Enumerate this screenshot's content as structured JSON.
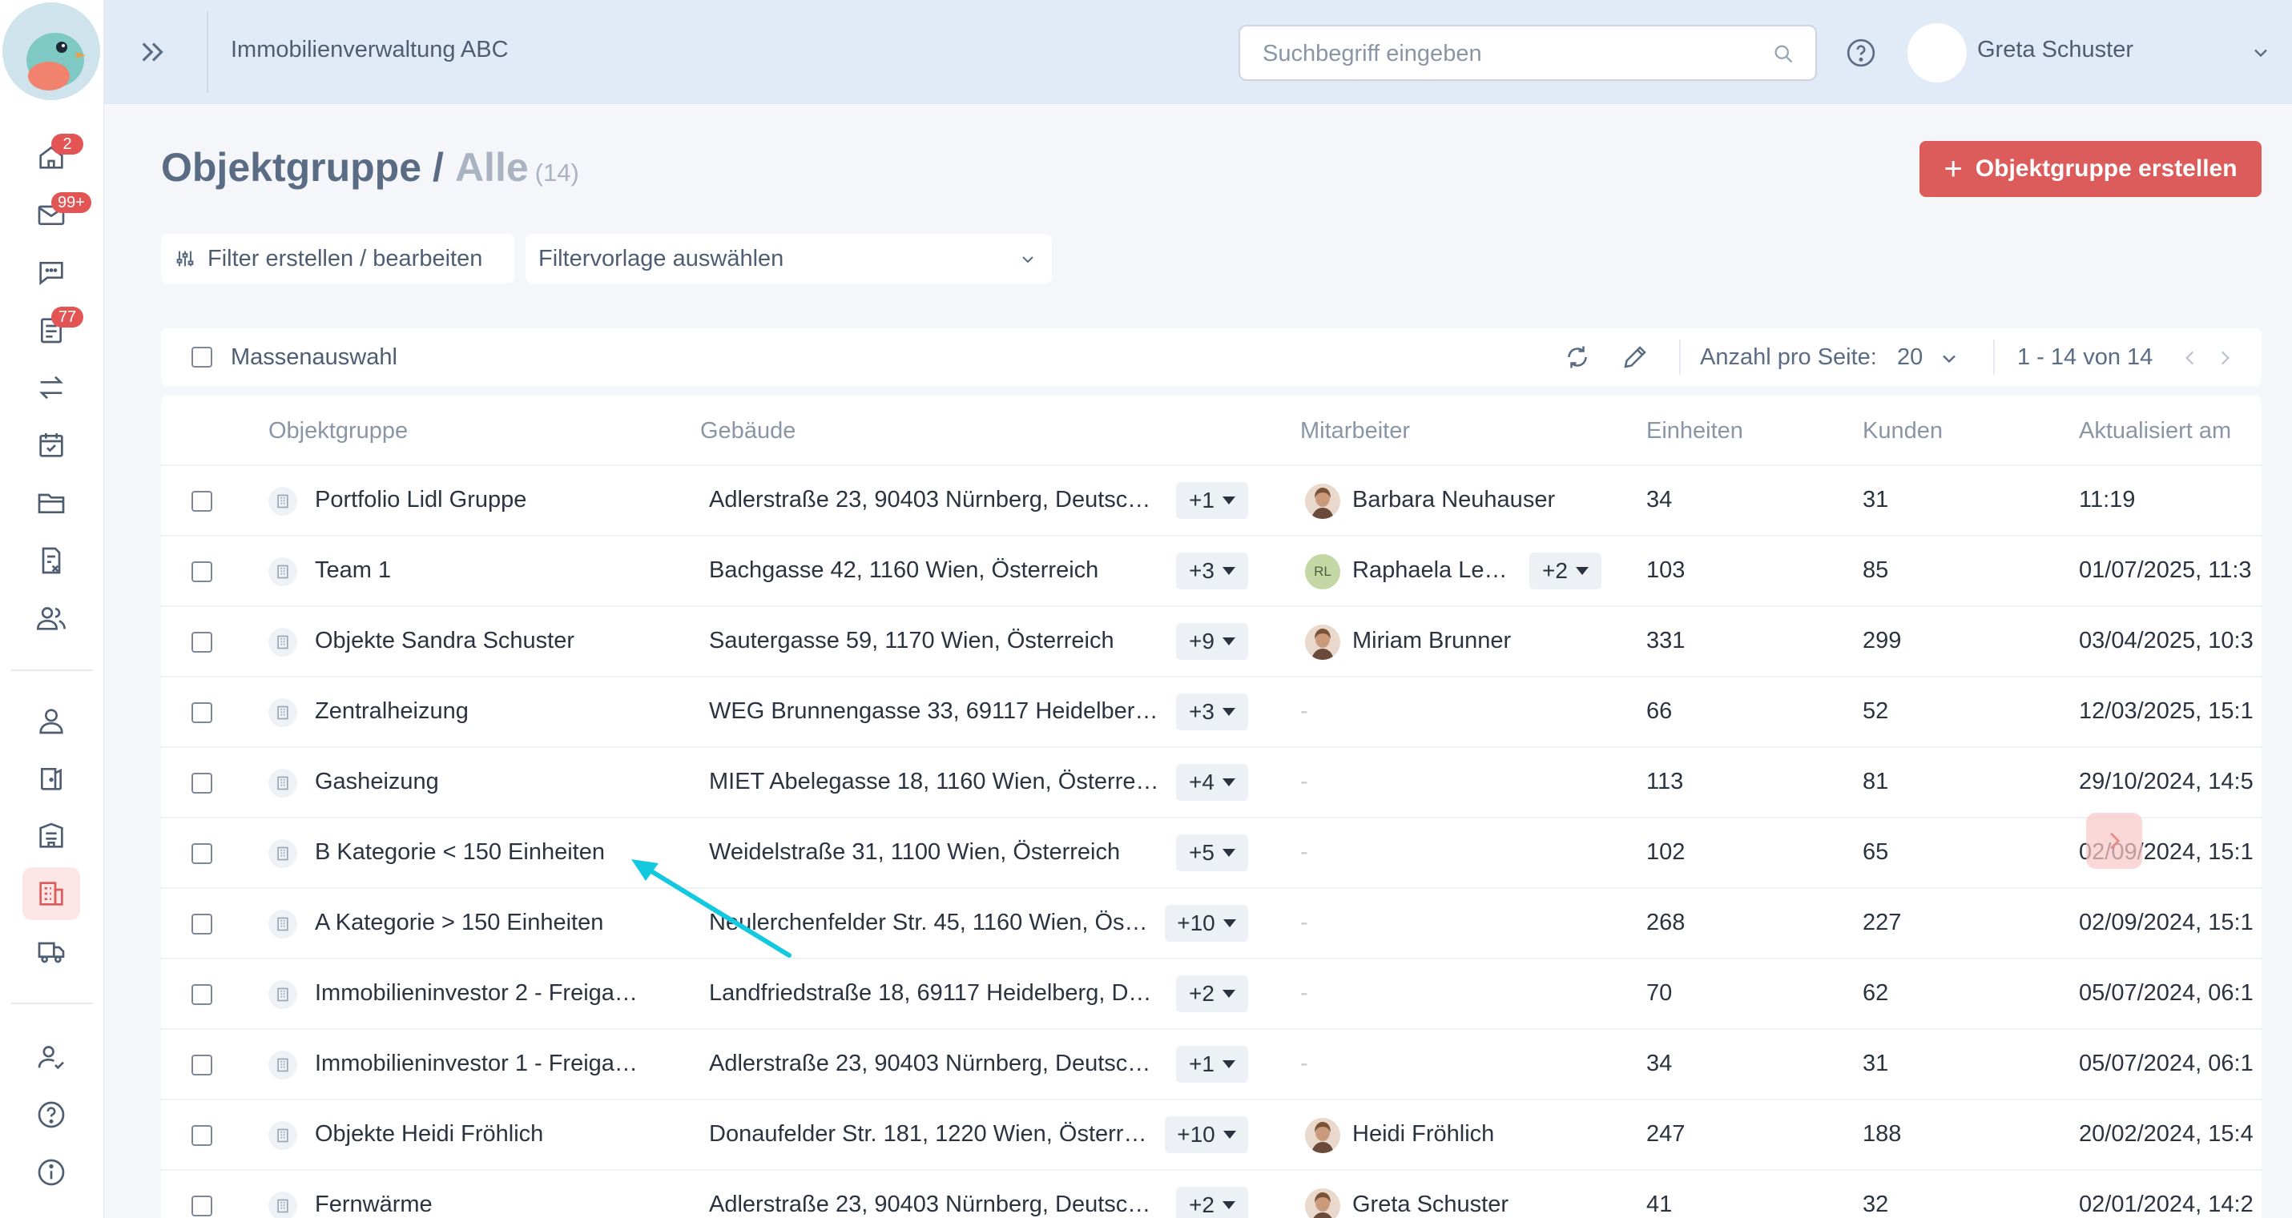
{
  "app": {
    "company": "Immobilienverwaltung ABC",
    "user_name": "Greta Schuster"
  },
  "search": {
    "placeholder": "Suchbegriff eingeben",
    "value": ""
  },
  "sidebar": {
    "items": [
      {
        "name": "home-icon",
        "badge": "2"
      },
      {
        "name": "mail-icon",
        "badge": "99+"
      },
      {
        "name": "chat-icon",
        "badge": ""
      },
      {
        "name": "tasks-icon",
        "badge": "77"
      },
      {
        "name": "transfer-icon",
        "badge": ""
      },
      {
        "name": "calendar-icon",
        "badge": ""
      },
      {
        "name": "folder-icon",
        "badge": ""
      },
      {
        "name": "invoice-icon",
        "badge": ""
      },
      {
        "name": "people-icon",
        "badge": ""
      },
      {
        "name": "person-icon",
        "badge": ""
      },
      {
        "name": "door-icon",
        "badge": ""
      },
      {
        "name": "building-icon",
        "badge": ""
      },
      {
        "name": "object-group-icon",
        "badge": "",
        "active": true
      },
      {
        "name": "truck-icon",
        "badge": ""
      },
      {
        "name": "user-check-icon",
        "badge": ""
      },
      {
        "name": "help-icon",
        "badge": ""
      },
      {
        "name": "info-icon",
        "badge": ""
      }
    ]
  },
  "page": {
    "title": "Objektgruppe",
    "separator": "/",
    "subtitle": "Alle",
    "count": "(14)",
    "create_button": "Objektgruppe erstellen"
  },
  "filters": {
    "edit_label": "Filter erstellen / bearbeiten",
    "template_placeholder": "Filtervorlage auswählen"
  },
  "toolbar": {
    "mass_select": "Massenauswahl",
    "per_page_label": "Anzahl pro Seite:",
    "per_page_value": "20",
    "range": "1 - 14 von 14"
  },
  "table": {
    "columns": [
      "Objektgruppe",
      "Gebäude",
      "Mitarbeiter",
      "Einheiten",
      "Kunden",
      "Aktualisiert am"
    ],
    "rows": [
      {
        "group": "Portfolio Lidl Gruppe",
        "building": "Adlerstraße 23, 90403 Nürnberg, Deutsc…",
        "building_more": "+1",
        "employee": "Barbara Neuhauser",
        "employee_more": "",
        "avatar": "photo",
        "units": "34",
        "customers": "31",
        "updated": "11:19"
      },
      {
        "group": "Team 1",
        "building": "Bachgasse 42, 1160 Wien, Österreich",
        "building_more": "+3",
        "employee": "Raphaela Le…",
        "employee_more": "+2",
        "avatar": "RL",
        "units": "103",
        "customers": "85",
        "updated": "01/07/2025, 11:3"
      },
      {
        "group": "Objekte Sandra Schuster",
        "building": "Sautergasse 59, 1170 Wien, Österreich",
        "building_more": "+9",
        "employee": "Miriam Brunner",
        "employee_more": "",
        "avatar": "photo",
        "units": "331",
        "customers": "299",
        "updated": "03/04/2025, 10:3"
      },
      {
        "group": "Zentralheizung",
        "building": "WEG Brunnengasse 33, 69117 Heidelber…",
        "building_more": "+3",
        "employee": "-",
        "employee_more": "",
        "avatar": "",
        "units": "66",
        "customers": "52",
        "updated": "12/03/2025, 15:1"
      },
      {
        "group": "Gasheizung",
        "building": "MIET Abelegasse 18, 1160 Wien, Österre…",
        "building_more": "+4",
        "employee": "-",
        "employee_more": "",
        "avatar": "",
        "units": "113",
        "customers": "81",
        "updated": "29/10/2024, 14:5"
      },
      {
        "group": "B Kategorie < 150 Einheiten",
        "building": "Weidelstraße 31, 1100 Wien, Österreich",
        "building_more": "+5",
        "employee": "-",
        "employee_more": "",
        "avatar": "",
        "units": "102",
        "customers": "65",
        "updated": "02/09/2024, 15:1"
      },
      {
        "group": "A Kategorie > 150 Einheiten",
        "building": "Neulerchenfelder Str. 45, 1160 Wien, Ös…",
        "building_more": "+10",
        "employee": "-",
        "employee_more": "",
        "avatar": "",
        "units": "268",
        "customers": "227",
        "updated": "02/09/2024, 15:1"
      },
      {
        "group": "Immobilieninvestor 2 - Freiga…",
        "building": "Landfriedstraße 18, 69117 Heidelberg, D…",
        "building_more": "+2",
        "employee": "-",
        "employee_more": "",
        "avatar": "",
        "units": "70",
        "customers": "62",
        "updated": "05/07/2024, 06:1"
      },
      {
        "group": "Immobilieninvestor 1 - Freiga…",
        "building": "Adlerstraße 23, 90403 Nürnberg, Deutsc…",
        "building_more": "+1",
        "employee": "-",
        "employee_more": "",
        "avatar": "",
        "units": "34",
        "customers": "31",
        "updated": "05/07/2024, 06:1"
      },
      {
        "group": "Objekte Heidi Fröhlich",
        "building": "Donaufelder Str. 181, 1220 Wien, Österr…",
        "building_more": "+10",
        "employee": "Heidi Fröhlich",
        "employee_more": "",
        "avatar": "photo",
        "units": "247",
        "customers": "188",
        "updated": "20/02/2024, 15:4"
      },
      {
        "group": "Fernwärme",
        "building": "Adlerstraße 23, 90403 Nürnberg, Deutsc…",
        "building_more": "+2",
        "employee": "Greta Schuster",
        "employee_more": "",
        "avatar": "photo",
        "units": "41",
        "customers": "32",
        "updated": "02/01/2024, 14:2"
      }
    ]
  },
  "colors": {
    "accent": "#dc5b5b",
    "topbar": "#e1ebf8",
    "badge": "#e35454",
    "annotation_arrow": "#12c9e0"
  }
}
